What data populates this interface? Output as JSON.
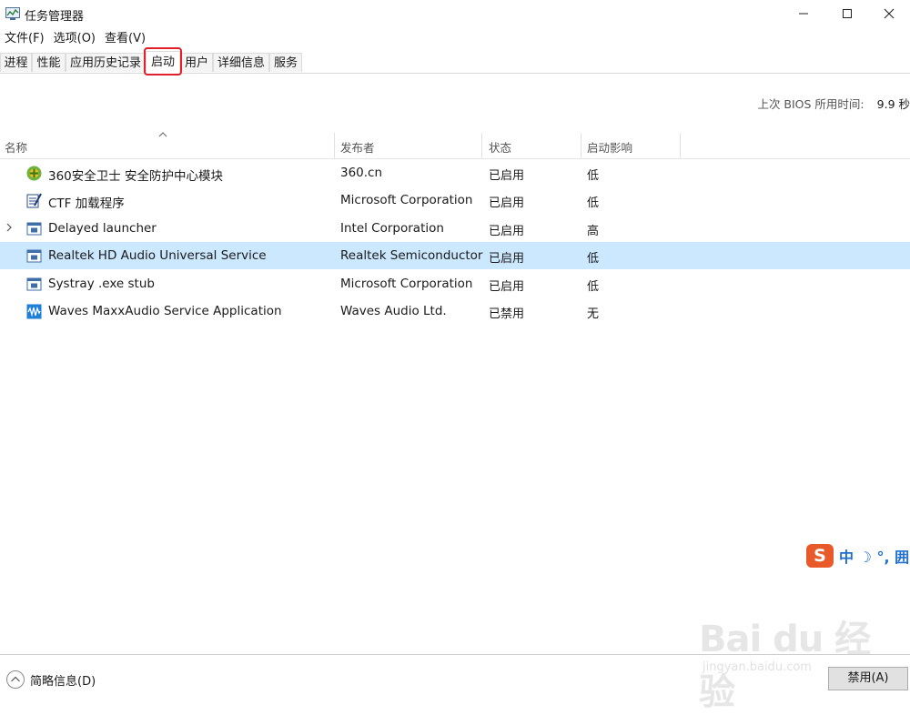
{
  "window": {
    "title": "任务管理器",
    "minimize_icon": "minimize-icon",
    "maximize_icon": "maximize-icon",
    "close_icon": "close-icon"
  },
  "menu": [
    "文件(F)",
    "选项(O)",
    "查看(V)"
  ],
  "tabs": [
    "进程",
    "性能",
    "应用历史记录",
    "启动",
    "用户",
    "详细信息",
    "服务"
  ],
  "active_tab": "启动",
  "highlight_color": "#e2202b",
  "bios": {
    "label": "上次 BIOS 所用时间:",
    "value": "9.9 秒"
  },
  "columns": [
    "名称",
    "发布者",
    "状态",
    "启动影响"
  ],
  "rows": [
    {
      "name": "360安全卫士 安全防护中心模块",
      "publisher": "360.cn",
      "status": "已启用",
      "impact": "低",
      "icon": "360-shield-icon"
    },
    {
      "name": "CTF 加载程序",
      "publisher": "Microsoft Corporation",
      "status": "已启用",
      "impact": "低",
      "icon": "ctf-loader-icon"
    },
    {
      "name": "Delayed launcher",
      "publisher": "Intel Corporation",
      "status": "已启用",
      "impact": "高",
      "icon": "app-window-icon",
      "expandable": true
    },
    {
      "name": "Realtek HD Audio Universal Service",
      "publisher": "Realtek Semiconductor",
      "status": "已启用",
      "impact": "低",
      "icon": "app-window-icon",
      "selected": true
    },
    {
      "name": "Systray .exe stub",
      "publisher": "Microsoft Corporation",
      "status": "已启用",
      "impact": "低",
      "icon": "app-window-icon"
    },
    {
      "name": "Waves MaxxAudio Service Application",
      "publisher": "Waves Audio Ltd.",
      "status": "已禁用",
      "impact": "无",
      "icon": "waves-audio-icon"
    }
  ],
  "selected_color": "#cce8ff",
  "ime": {
    "logo": "S",
    "text": "中 ☽ °, 囲"
  },
  "watermark": {
    "main": "Bai du 经验",
    "sub": "jingyan.baidu.com"
  },
  "footer": {
    "toggle_label": "简略信息(D)",
    "disable_button": "禁用(A)"
  }
}
